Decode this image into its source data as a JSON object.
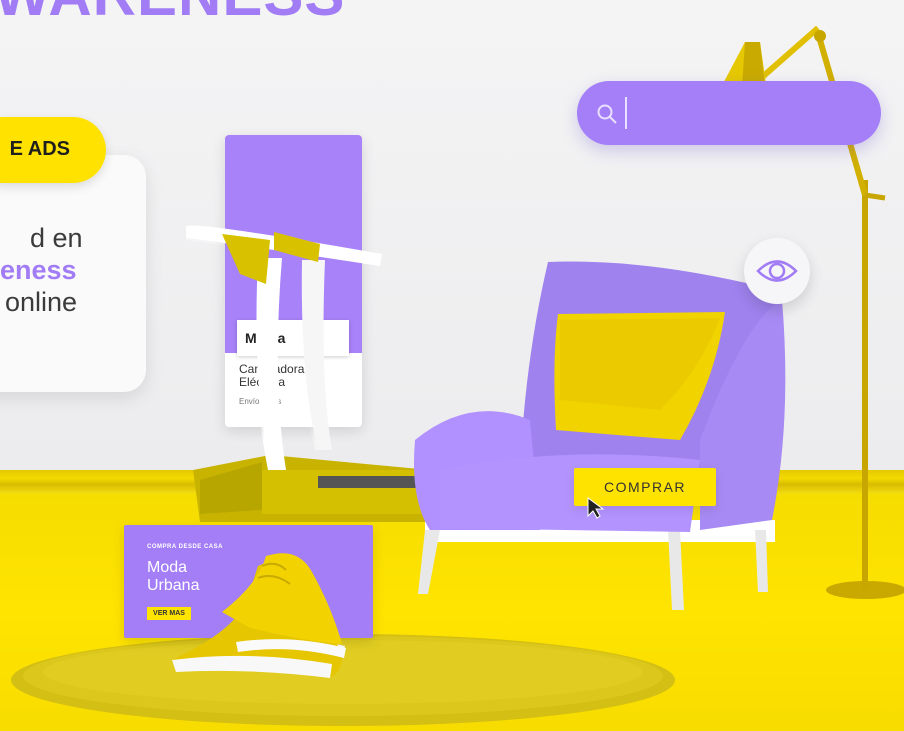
{
  "headline": "WARENESS",
  "pill_label": "E ADS",
  "info": {
    "line1": "d en",
    "line2": "eness",
    "line3": "online"
  },
  "banner_vertical": {
    "brand": "Marca",
    "product_line1": "Caminadora",
    "product_line2": "Eléctrica",
    "shipping": "Envío gratis"
  },
  "comprar_label": "COMPRAR",
  "banner_horizontal": {
    "kicker": "COMPRA DESDE CASA",
    "headline_line1": "Moda",
    "headline_line2": "Urbana",
    "cta": "VER MAS"
  },
  "colors": {
    "purple": "#a17cf5",
    "yellow": "#ffe200",
    "wall": "#f2f2f3"
  },
  "icons": [
    "search-icon",
    "eye-icon",
    "mouse-cursor-icon"
  ]
}
